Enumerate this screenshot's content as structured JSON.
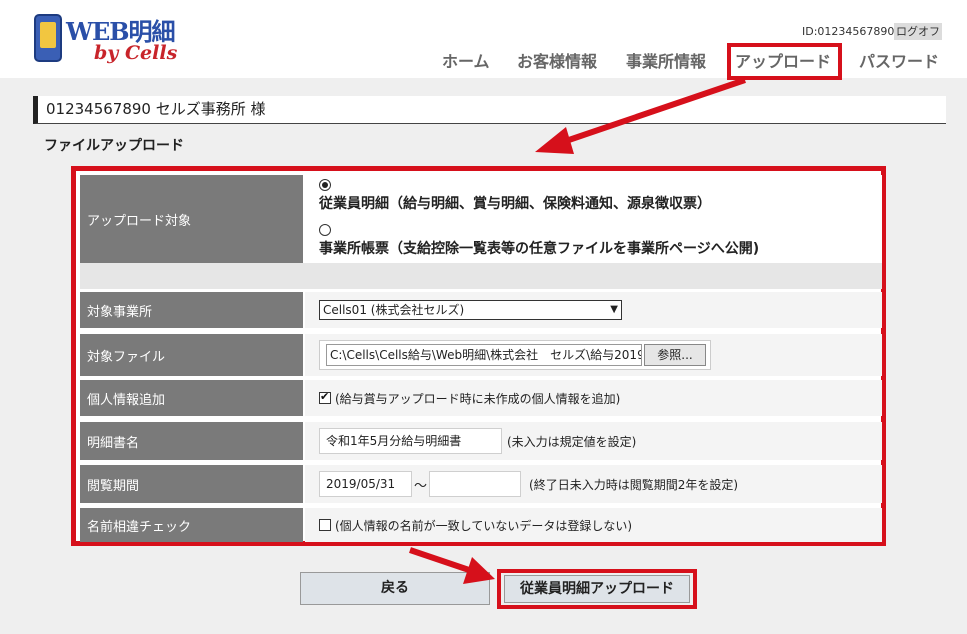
{
  "logo": {
    "brand": "WEB明細",
    "tagline": "by Cells"
  },
  "header": {
    "user_id": "ID:01234567890",
    "logout_label": "ログオフ"
  },
  "nav": [
    {
      "label": "ホーム"
    },
    {
      "label": "お客様情報"
    },
    {
      "label": "事業所情報"
    },
    {
      "label": "アップロード"
    },
    {
      "label": "パスワード"
    }
  ],
  "account": {
    "name": "01234567890 セルズ事務所 様"
  },
  "page": {
    "title": "ファイルアップロード"
  },
  "form": {
    "upload_target": {
      "label": "アップロード対象",
      "options": [
        {
          "text": "従業員明細（給与明細、賞与明細、保険料通知、源泉徴収票）",
          "selected": true
        },
        {
          "text": "事業所帳票（支給控除一覧表等の任意ファイルを事業所ページへ公開)",
          "selected": false
        }
      ]
    },
    "office": {
      "label": "対象事業所",
      "value": "Cells01 (株式会社セルズ)"
    },
    "file": {
      "label": "対象ファイル",
      "path": "C:\\Cells\\Cells給与\\Web明細\\株式会社　セルズ\\給与2019",
      "browse_label": "参照..."
    },
    "personal_info": {
      "label": "個人情報追加",
      "checked": true,
      "text": "(給与賞与アップロード時に未作成の個人情報を追加)"
    },
    "statement_name": {
      "label": "明細書名",
      "value": "令和1年5月分給与明細書",
      "hint": "(未入力は規定値を設定)"
    },
    "period": {
      "label": "閲覧期間",
      "start": "2019/05/31",
      "separator": "～",
      "end": "",
      "hint": "(終了日未入力時は閲覧期間2年を設定)"
    },
    "name_check": {
      "label": "名前相違チェック",
      "checked": false,
      "text": "(個人情報の名前が一致していないデータは登録しない)"
    }
  },
  "buttons": {
    "back_label": "戻る",
    "upload_label": "従業員明細アップロード"
  },
  "colors": {
    "highlight": "#d6101b",
    "label_bg": "#7a7a7a",
    "brand_blue": "#2a4fa8",
    "brand_red": "#c8242a"
  }
}
